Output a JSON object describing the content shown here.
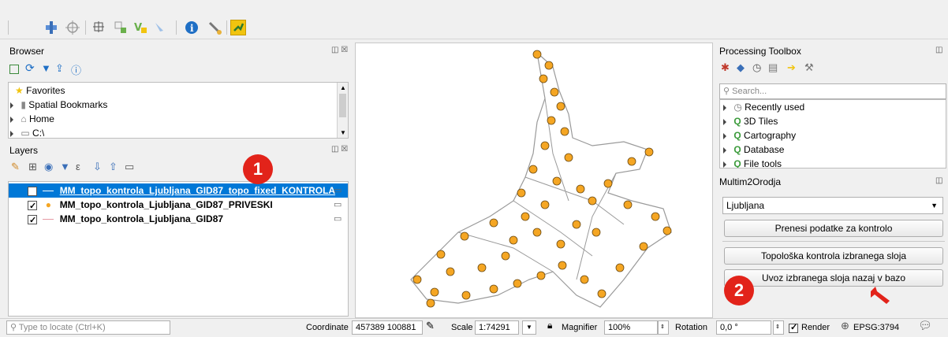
{
  "toolbar": {
    "icons": [
      "pan-map-icon",
      "crosshair-icon",
      "node-tool-icon",
      "vertex-tool-icon",
      "style-icon",
      "identify-feature-icon",
      "info-icon",
      "settings-wrench-icon",
      "plugin-icon"
    ]
  },
  "browser": {
    "title": "Browser",
    "items": [
      {
        "label": "Favorites"
      },
      {
        "label": "Spatial Bookmarks"
      },
      {
        "label": "Home"
      },
      {
        "label": "C:\\"
      }
    ]
  },
  "layers": {
    "title": "Layers",
    "items": [
      {
        "label": "MM_topo_kontrola_Ljubljana_GID87_topo_fixed_KONTROLA",
        "selected": true
      },
      {
        "label": "MM_topo_kontrola_Ljubljana_GID87_PRIVESKI",
        "selected": false
      },
      {
        "label": "MM_topo_kontrola_Ljubljana_GID87",
        "selected": false
      }
    ]
  },
  "annotations": {
    "one": "1",
    "two": "2"
  },
  "processing": {
    "title": "Processing Toolbox",
    "search_placeholder": "Search...",
    "items": [
      {
        "label": "Recently used"
      },
      {
        "label": "3D Tiles"
      },
      {
        "label": "Cartography"
      },
      {
        "label": "Database"
      },
      {
        "label": "File tools"
      }
    ]
  },
  "multim": {
    "title": "Multim2Orodja",
    "select_value": "Ljubljana",
    "btn_transfer": "Prenesi podatke za kontrolo",
    "btn_topology": "Topološka kontrola izbranega sloja",
    "btn_import": "Uvoz izbranega sloja nazaj v bazo"
  },
  "status": {
    "locate_placeholder": "Type to locate (Ctrl+K)",
    "coordinate_label": "Coordinate",
    "coordinate_value": "457389  100881",
    "scale_label": "Scale",
    "scale_value": "1:74291",
    "magnifier_label": "Magnifier",
    "magnifier_value": "100%",
    "rotation_label": "Rotation",
    "rotation_value": "0,0 °",
    "render_label": "Render",
    "crs_label": "EPSG:3794"
  },
  "colors": {
    "accent": "#0078d7",
    "selection": "#0078d7",
    "points": "#f5a623",
    "lines": "#9a9a9a",
    "badge": "#e2231a"
  }
}
